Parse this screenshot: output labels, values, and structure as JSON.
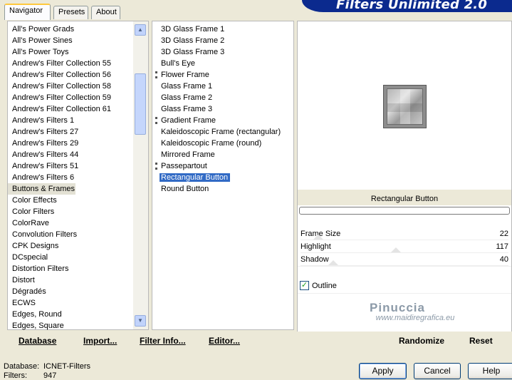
{
  "banner": {
    "title": "Filters Unlimited 2.0",
    "bg_color": "#0b2a8e"
  },
  "tabs": [
    {
      "label": "Navigator",
      "active": true
    },
    {
      "label": "Presets",
      "active": false
    },
    {
      "label": "About",
      "active": false
    }
  ],
  "categories": {
    "items": [
      "All's Power Grads",
      "All's Power Sines",
      "All's Power Toys",
      "Andrew's Filter Collection 55",
      "Andrew's Filter Collection 56",
      "Andrew's Filter Collection 58",
      "Andrew's Filter Collection 59",
      "Andrew's Filter Collection 61",
      "Andrew's Filters 1",
      "Andrew's Filters 27",
      "Andrew's Filters 29",
      "Andrew's Filters 44",
      "Andrew's Filters 51",
      "Andrew's Filters 6",
      "Buttons & Frames",
      "Color Effects",
      "Color Filters",
      "ColorRave",
      "Convolution Filters",
      "CPK Designs",
      "DCspecial",
      "Distortion Filters",
      "Distort",
      "Dégradés",
      "ECWS",
      "Edges, Round",
      "Edges, Square"
    ],
    "selected": "Buttons & Frames"
  },
  "filters": {
    "items": [
      {
        "label": "3D Glass Frame 1",
        "marked": false
      },
      {
        "label": "3D Glass Frame 2",
        "marked": false
      },
      {
        "label": "3D Glass Frame 3",
        "marked": false
      },
      {
        "label": "Bull's Eye",
        "marked": false
      },
      {
        "label": "Flower Frame",
        "marked": true
      },
      {
        "label": "Glass Frame 1",
        "marked": false
      },
      {
        "label": "Glass Frame 2",
        "marked": false
      },
      {
        "label": "Glass Frame 3",
        "marked": false
      },
      {
        "label": "Gradient Frame",
        "marked": true
      },
      {
        "label": "Kaleidoscopic Frame (rectangular)",
        "marked": false
      },
      {
        "label": "Kaleidoscopic Frame (round)",
        "marked": false
      },
      {
        "label": "Mirrored Frame",
        "marked": false
      },
      {
        "label": "Passepartout",
        "marked": true
      },
      {
        "label": "Rectangular Button",
        "marked": false
      },
      {
        "label": "Round Button",
        "marked": false
      }
    ],
    "selected": "Rectangular Button",
    "selected_color": "#316ac5"
  },
  "preview": {
    "filter_name": "Rectangular Button",
    "params": [
      {
        "label": "Frame Size",
        "value": "22",
        "level": 22
      },
      {
        "label": "Highlight",
        "value": "117",
        "level": 117
      },
      {
        "label": "Shadow",
        "value": "40",
        "level": 40
      }
    ],
    "outline": {
      "label": "Outline",
      "checked": true
    },
    "watermark": {
      "name": "Pinuccia",
      "url": "www.maidiregrafica.eu"
    }
  },
  "left_bar": {
    "database": "Database",
    "import": "Import...",
    "filter_info": "Filter Info...",
    "editor": "Editor..."
  },
  "right_bar": {
    "randomize": "Randomize",
    "reset": "Reset"
  },
  "status": {
    "database_label": "Database:",
    "database_value": "ICNET-Filters",
    "filters_label": "Filters:",
    "filters_value": "947"
  },
  "dialog": {
    "apply": "Apply",
    "cancel": "Cancel",
    "help": "Help"
  },
  "icons": {
    "scroll_up": "chevron-up-icon",
    "scroll_down": "chevron-down-icon",
    "check": "checkmark-icon"
  }
}
